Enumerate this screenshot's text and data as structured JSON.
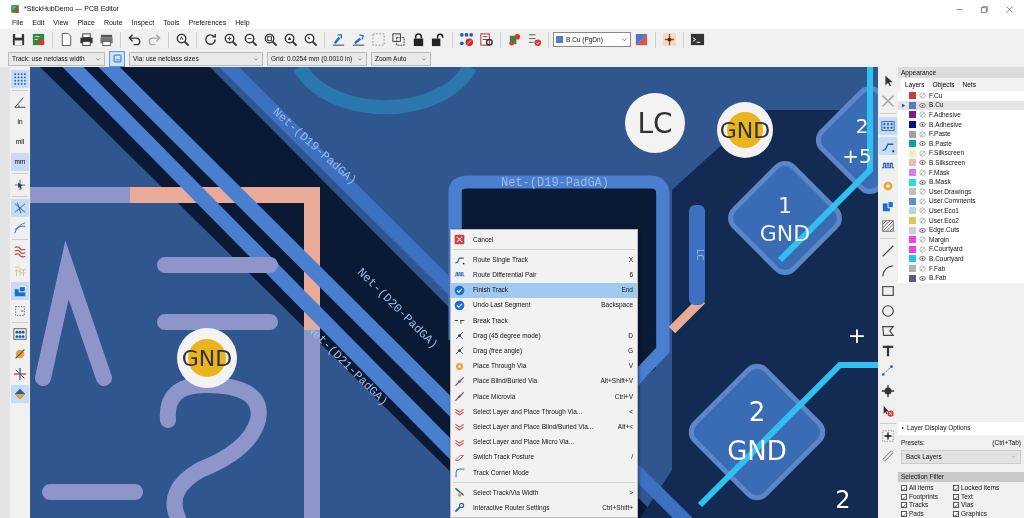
{
  "window": {
    "title": "*StickHubDemo — PCB Editor"
  },
  "menu_bar": [
    "File",
    "Edit",
    "View",
    "Place",
    "Route",
    "Inspect",
    "Tools",
    "Preferences",
    "Help"
  ],
  "layer_selector": {
    "value": "B.Cu (PgDn)"
  },
  "track_width": {
    "value": "Track: use netclass width"
  },
  "track_via_toggle": {
    "selected": true
  },
  "via_size": {
    "value": "Via: use netclass sizes"
  },
  "grid": {
    "value": "Grid: 0.0254 mm (0.0010 in)"
  },
  "zoom": {
    "value": "Zoom Auto"
  },
  "left_toolbar": [
    {
      "kind": "icon",
      "selected": true
    },
    {
      "kind": "icon",
      "selected": false
    },
    {
      "kind": "text",
      "label": "in",
      "selected": false
    },
    {
      "kind": "text",
      "label": "mil",
      "selected": false
    },
    {
      "kind": "text",
      "label": "mm",
      "selected": true
    },
    {
      "kind": "icon",
      "selected": false
    },
    {
      "kind": "icon",
      "selected": true
    },
    {
      "kind": "icon",
      "selected": false
    },
    {
      "kind": "icon",
      "selected": false
    },
    {
      "kind": "icon",
      "selected": false
    },
    {
      "kind": "icon",
      "selected": true
    },
    {
      "kind": "icon",
      "selected": false
    },
    {
      "kind": "icon",
      "selected": false
    },
    {
      "kind": "icon",
      "selected": false
    },
    {
      "kind": "icon",
      "selected": false
    },
    {
      "kind": "icon",
      "selected": true
    }
  ],
  "right_toolbar": [
    {
      "selected": false
    },
    {
      "selected": false
    },
    {
      "selected": true
    },
    {
      "selected": true
    },
    {
      "selected": false
    },
    {
      "selected": false
    },
    {
      "selected": false
    },
    {
      "selected": false
    },
    {
      "selected": false
    },
    {
      "selected": false
    },
    {
      "selected": false
    },
    {
      "selected": false
    },
    {
      "selected": false
    },
    {
      "selected": false
    },
    {
      "selected": false
    },
    {
      "selected": false
    },
    {
      "selected": false
    },
    {
      "selected": false
    },
    {
      "selected": false
    }
  ],
  "canvas": {
    "net_labels": [
      "Net-(D19-PadGA)",
      "Net-(D19-PadGA)",
      "Net-(D20-PadGA)",
      "Net-(D21-PadGA)"
    ],
    "pad_labels": [
      "GND",
      "LC",
      "GND",
      "1",
      "GND",
      "2",
      "GND",
      "2",
      "+5",
      "+",
      "2",
      "LC"
    ]
  },
  "context_menu": {
    "sections": [
      [
        {
          "label": "Cancel",
          "selected": false
        }
      ],
      [
        {
          "label": "Route Single Track",
          "shortcut": "X",
          "selected": false
        },
        {
          "label": "Route Differential Pair",
          "shortcut": "6",
          "selected": false
        },
        {
          "label": "Finish Track",
          "shortcut": "End",
          "selected": true
        },
        {
          "label": "Undo Last Segment",
          "shortcut": "Backspace",
          "selected": false
        },
        {
          "label": "Break Track",
          "selected": false
        },
        {
          "label": "Drag (45 degree mode)",
          "shortcut": "D",
          "selected": false
        },
        {
          "label": "Drag (free angle)",
          "shortcut": "G",
          "selected": false
        },
        {
          "label": "Place Through Via",
          "shortcut": "V",
          "selected": false
        },
        {
          "label": "Place Blind/Buried Via",
          "shortcut": "Alt+Shift+V",
          "selected": false
        },
        {
          "label": "Place Microvia",
          "shortcut": "Ctrl+V",
          "selected": false
        },
        {
          "label": "Select Layer and Place Through Via...",
          "shortcut": "<",
          "selected": false
        },
        {
          "label": "Select Layer and Place Blind/Buried Via...",
          "shortcut": "Alt+<",
          "selected": false
        },
        {
          "label": "Select Layer and Place Micro Via...",
          "selected": false
        },
        {
          "label": "Switch Track Posture",
          "shortcut": "/",
          "selected": false
        },
        {
          "label": "Track Corner Mode",
          "selected": false
        }
      ],
      [
        {
          "label": "Select Track/Via Width",
          "shortcut": ">",
          "selected": false
        },
        {
          "label": "Interactive Router Settings",
          "shortcut": "Ctrl+Shift+",
          "selected": false
        }
      ]
    ]
  },
  "appearance": {
    "title": "Appearance",
    "tabs": [
      {
        "label": "Layers",
        "selected": true
      },
      {
        "label": "Objects",
        "selected": false
      },
      {
        "label": "Nets",
        "selected": false
      }
    ],
    "layers": [
      {
        "name": "F.Cu",
        "color": "#c83c3c",
        "visible": false,
        "selected": false
      },
      {
        "name": "B.Cu",
        "color": "#4d7fc4",
        "visible": true,
        "selected": true
      },
      {
        "name": "F.Adhesive",
        "color": "#841a84",
        "visible": false,
        "selected": false
      },
      {
        "name": "B.Adhesive",
        "color": "#000c84",
        "visible": true,
        "selected": false
      },
      {
        "name": "F.Paste",
        "color": "#a8a0a0",
        "visible": false,
        "selected": false
      },
      {
        "name": "B.Paste",
        "color": "#10a0a0",
        "visible": true,
        "selected": false
      },
      {
        "name": "F.Silkscreen",
        "color": "#f0f0b0",
        "visible": false,
        "selected": false
      },
      {
        "name": "B.Silkscreen",
        "color": "#e8c0b0",
        "visible": true,
        "selected": false
      },
      {
        "name": "F.Mask",
        "color": "#d87ee8",
        "visible": false,
        "selected": false
      },
      {
        "name": "B.Mask",
        "color": "#20e0e0",
        "visible": true,
        "selected": false
      },
      {
        "name": "User.Drawings",
        "color": "#c0c0c0",
        "visible": false,
        "selected": false
      },
      {
        "name": "User.Comments",
        "color": "#5890d8",
        "visible": false,
        "selected": false
      },
      {
        "name": "User.Eco1",
        "color": "#b8d8d0",
        "visible": false,
        "selected": false
      },
      {
        "name": "User.Eco2",
        "color": "#d8c858",
        "visible": false,
        "selected": false
      },
      {
        "name": "Edge.Cuts",
        "color": "#d0d0d0",
        "visible": true,
        "selected": false
      },
      {
        "name": "Margin",
        "color": "#f040f0",
        "visible": false,
        "selected": false
      },
      {
        "name": "F.Courtyard",
        "color": "#f040e0",
        "visible": false,
        "selected": false
      },
      {
        "name": "B.Courtyard",
        "color": "#20c8f0",
        "visible": true,
        "selected": false
      },
      {
        "name": "F.Fab",
        "color": "#b0b0b0",
        "visible": false,
        "selected": false
      },
      {
        "name": "B.Fab",
        "color": "#585890",
        "visible": true,
        "selected": false
      }
    ],
    "display_options": "Layer Display Options",
    "presets_label": "Presets:",
    "presets_shortcut": "(Ctrl+Tab)",
    "preset": "Back Layers"
  },
  "selection_filter": {
    "title": "Selection Filter",
    "options": [
      {
        "label": "All items",
        "checked": true
      },
      {
        "label": "Locked items",
        "checked": true
      },
      {
        "label": "Footprints",
        "checked": true
      },
      {
        "label": "Text",
        "checked": true
      },
      {
        "label": "Tracks",
        "checked": true
      },
      {
        "label": "Vias",
        "checked": true
      },
      {
        "label": "Pads",
        "checked": true
      },
      {
        "label": "Graphics",
        "checked": true
      }
    ]
  }
}
